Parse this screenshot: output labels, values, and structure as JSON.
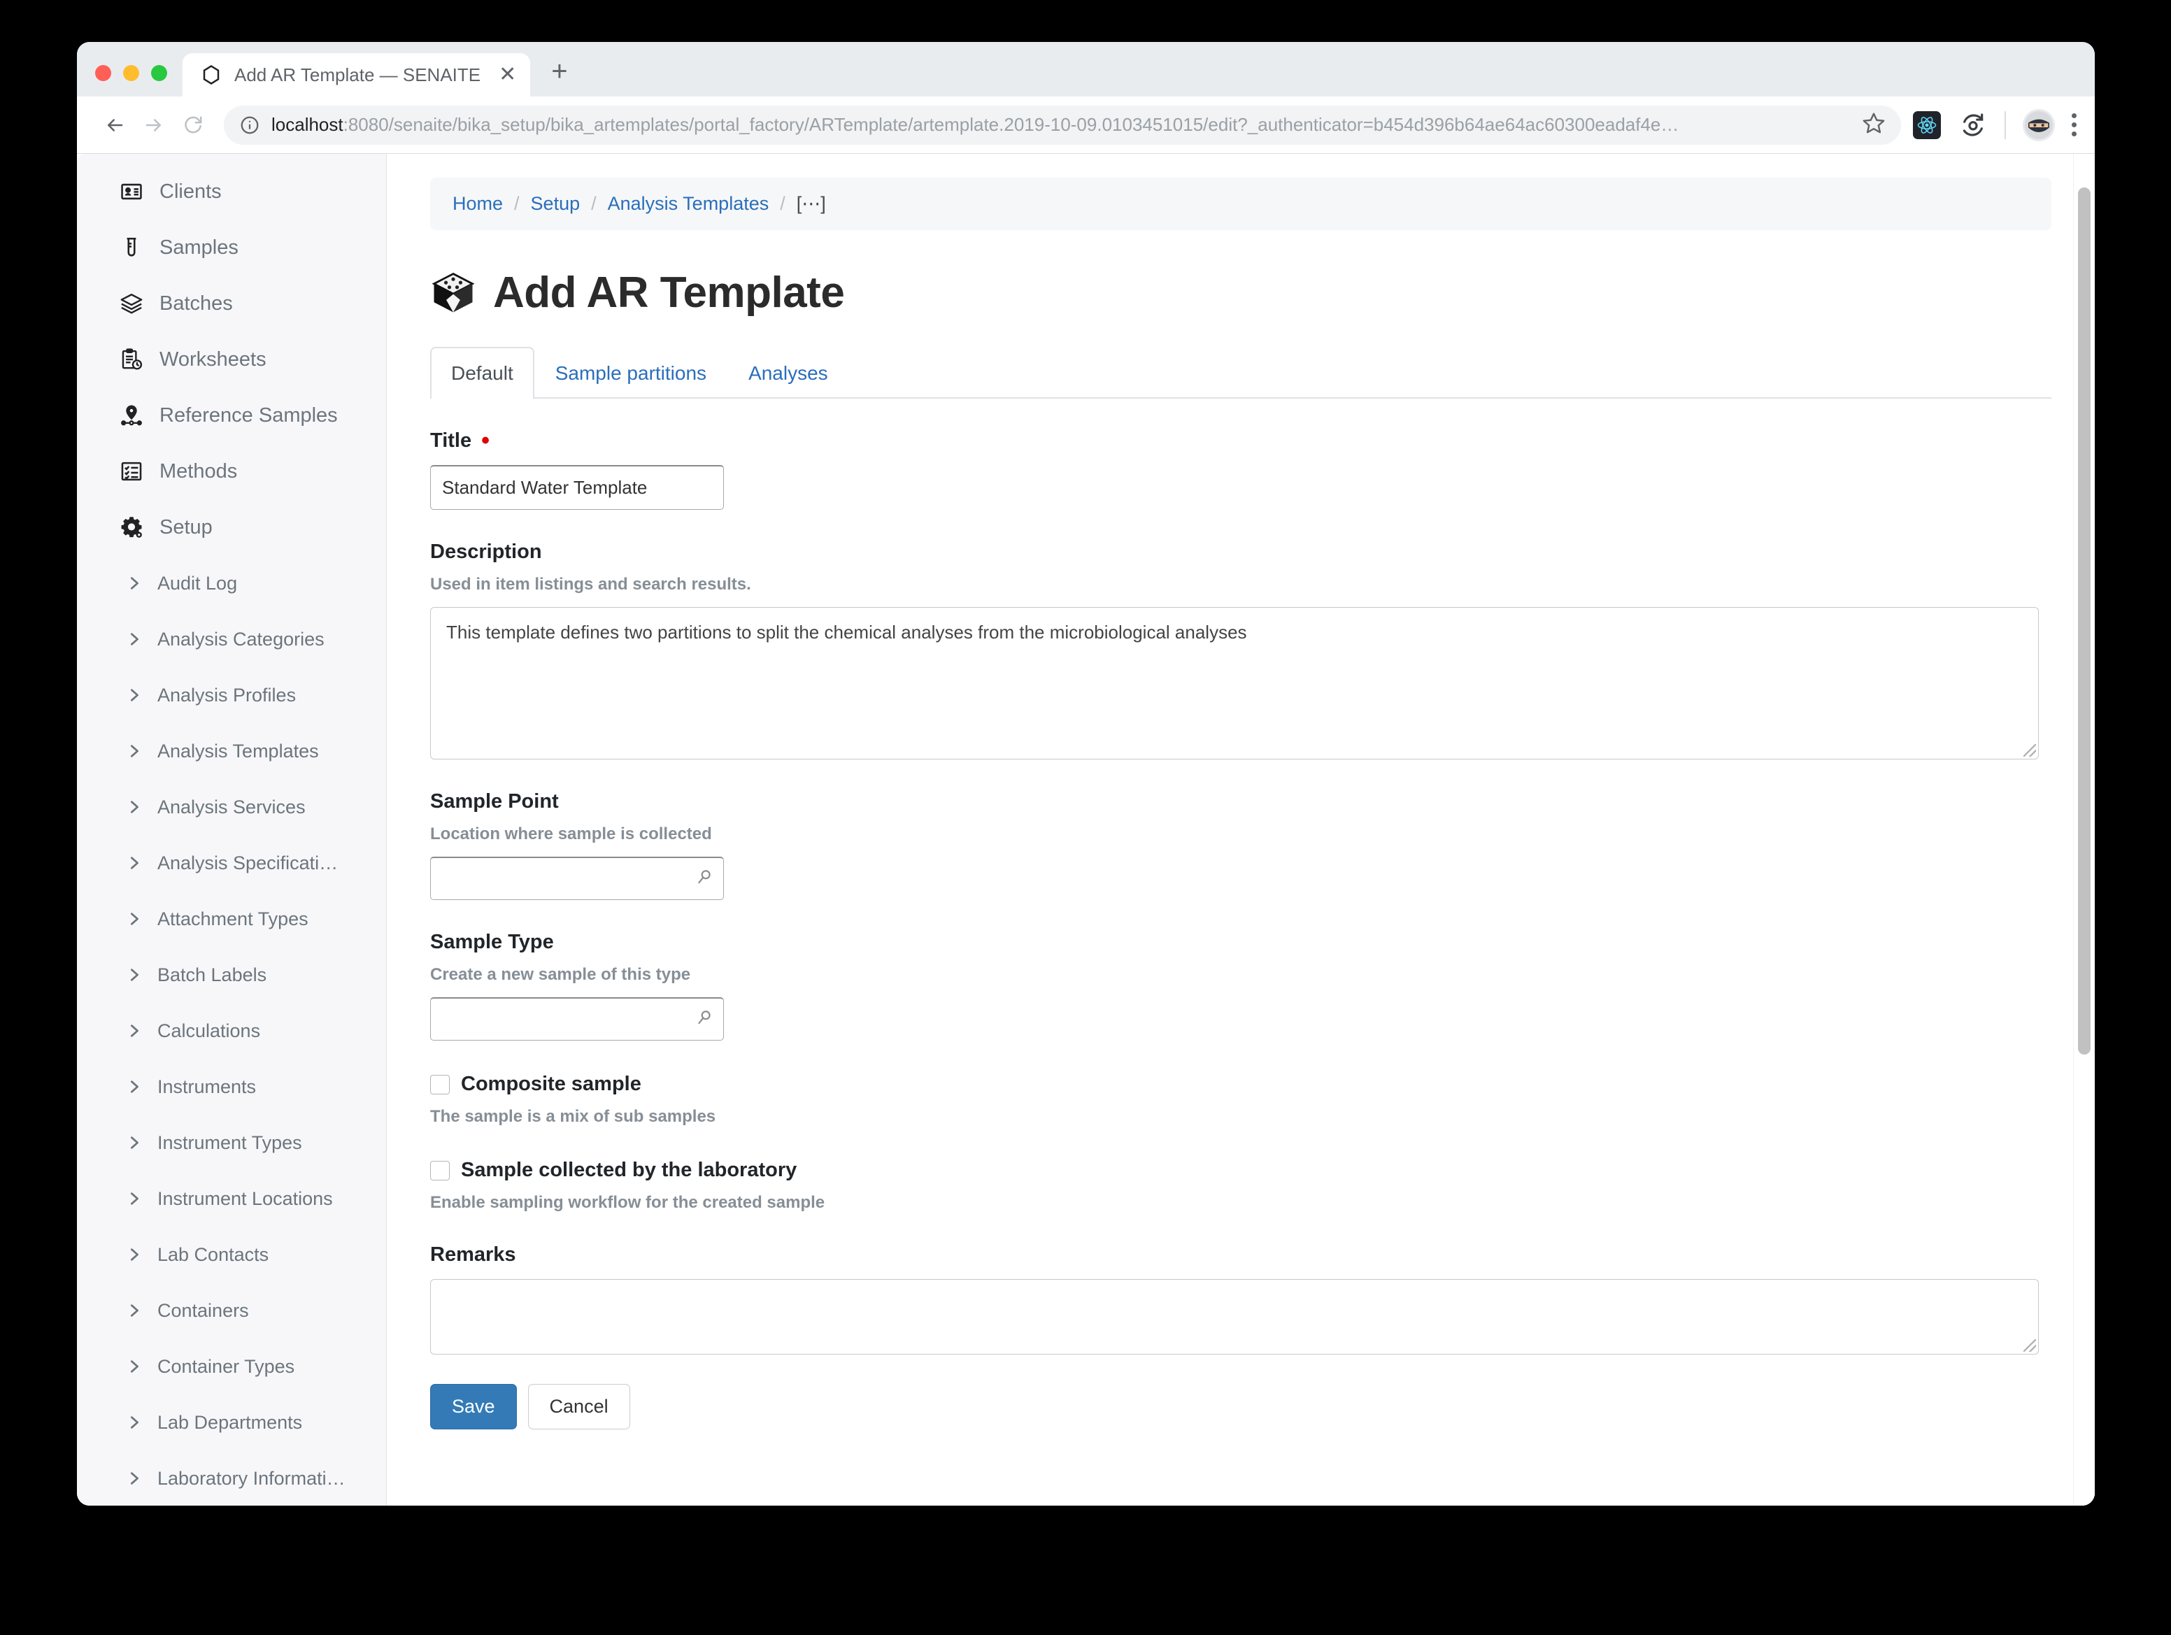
{
  "browser": {
    "tab": {
      "title": "Add AR Template — SENAITE",
      "favicon_icon": "hexagon-icon",
      "close_icon": "close-icon",
      "new_tab_icon": "plus-icon"
    },
    "toolbar": {
      "back_icon": "back-arrow-icon",
      "forward_icon": "forward-arrow-icon",
      "reload_icon": "reload-icon",
      "info_icon": "info-circle-icon",
      "url_host": "localhost",
      "url_rest": ":8080/senaite/bika_setup/bika_artemplates/portal_factory/ARTemplate/artemplate.2019-10-09.0103451015/edit?_authenticator=b454d396b64ae64ac60300eadaf4e…",
      "bookmark_icon": "star-icon",
      "extension_react_icon": "react-devtools-icon",
      "extension_reload_icon": "auto-refresh-icon",
      "profile_icon": "ninja-avatar-icon",
      "menu_icon": "kebab-menu-icon"
    }
  },
  "sidebar": {
    "items": [
      {
        "label": "Clients",
        "icon": "contact-card-icon"
      },
      {
        "label": "Samples",
        "icon": "test-tube-icon"
      },
      {
        "label": "Batches",
        "icon": "layers-icon"
      },
      {
        "label": "Worksheets",
        "icon": "clipboard-clock-icon"
      },
      {
        "label": "Reference Samples",
        "icon": "map-pin-icon"
      },
      {
        "label": "Methods",
        "icon": "checklist-icon"
      },
      {
        "label": "Setup",
        "icon": "gear-icon"
      }
    ],
    "subitems": [
      {
        "label": "Audit Log"
      },
      {
        "label": "Analysis Categories"
      },
      {
        "label": "Analysis Profiles"
      },
      {
        "label": "Analysis Templates"
      },
      {
        "label": "Analysis Services"
      },
      {
        "label": "Analysis Specificati…"
      },
      {
        "label": "Attachment Types"
      },
      {
        "label": "Batch Labels"
      },
      {
        "label": "Calculations"
      },
      {
        "label": "Instruments"
      },
      {
        "label": "Instrument Types"
      },
      {
        "label": "Instrument Locations"
      },
      {
        "label": "Lab Contacts"
      },
      {
        "label": "Containers"
      },
      {
        "label": "Container Types"
      },
      {
        "label": "Lab Departments"
      },
      {
        "label": "Laboratory Informati…"
      }
    ]
  },
  "breadcrumb": {
    "home": "Home",
    "setup": "Setup",
    "analysis_templates": "Analysis Templates",
    "current": "[⋯]",
    "separator": "/"
  },
  "page": {
    "title": "Add AR Template",
    "title_icon": "cube-box-icon"
  },
  "tabs": [
    {
      "label": "Default",
      "active": true
    },
    {
      "label": "Sample partitions",
      "active": false
    },
    {
      "label": "Analyses",
      "active": false
    }
  ],
  "form": {
    "title_field": {
      "label": "Title",
      "required_marker": "•",
      "value": "Standard Water Template"
    },
    "description_field": {
      "label": "Description",
      "help": "Used in item listings and search results.",
      "value": "This template defines two partitions to split the chemical analyses from the microbiological analyses"
    },
    "sample_point_field": {
      "label": "Sample Point",
      "help": "Location where sample is collected",
      "value": "",
      "search_icon": "search-icon"
    },
    "sample_type_field": {
      "label": "Sample Type",
      "help": "Create a new sample of this type",
      "value": "",
      "search_icon": "search-icon"
    },
    "composite_sample": {
      "label": "Composite sample",
      "help": "The sample is a mix of sub samples",
      "checked": false
    },
    "sample_collected_by_lab": {
      "label": "Sample collected by the laboratory",
      "help": "Enable sampling workflow for the created sample",
      "checked": false
    },
    "remarks_field": {
      "label": "Remarks",
      "value": ""
    },
    "save_button": "Save",
    "cancel_button": "Cancel"
  },
  "colors": {
    "link": "#2a6ebb",
    "primary_button": "#337ab7",
    "required": "#e00000",
    "sidebar_bg": "#f7f7f9"
  }
}
